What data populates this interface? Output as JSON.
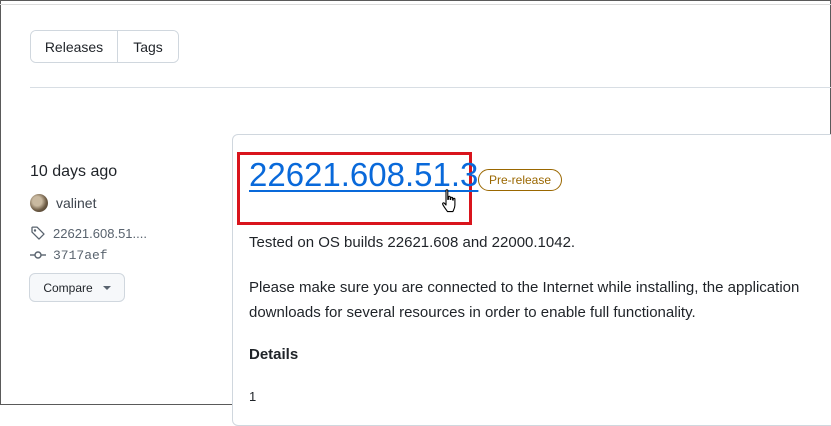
{
  "tabs": {
    "releases_label": "Releases",
    "tags_label": "Tags"
  },
  "sidebar": {
    "time_ago": "10 days ago",
    "author": "valinet",
    "tag": "22621.608.51....",
    "commit": "3717aef",
    "compare_label": "Compare"
  },
  "release": {
    "title": "22621.608.51.3",
    "badge": "Pre-release",
    "line1": "Tested on OS builds 22621.608 and 22000.1042.",
    "line2a": "Please make sure you are connected to the Internet while installing, the application",
    "line2b": "downloads for several resources in order to enable full functionality.",
    "details_heading": "Details",
    "list_start": "1"
  },
  "colors": {
    "link": "#0969da",
    "highlight": "#d9141c",
    "prerelease": "#9a6700"
  },
  "icons": [
    "tag-icon",
    "commit-icon",
    "caret-down-icon",
    "hand-pointer-icon"
  ]
}
